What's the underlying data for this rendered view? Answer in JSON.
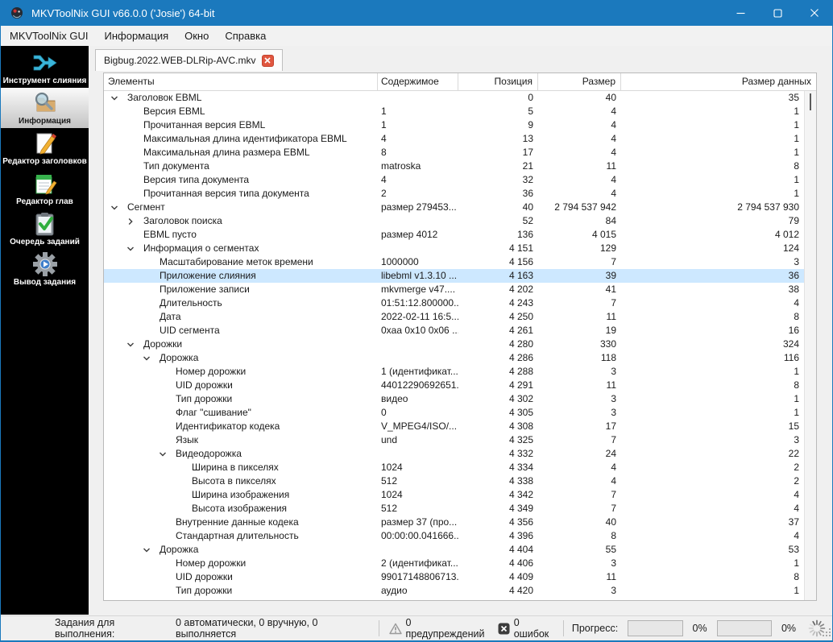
{
  "window": {
    "title": "MKVToolNix GUI v66.0.0 ('Josie') 64-bit"
  },
  "menu": {
    "items": [
      "MKVToolNix GUI",
      "Информация",
      "Окно",
      "Справка"
    ]
  },
  "sidebar": {
    "items": [
      {
        "label": "Инструмент слияния",
        "icon": "merge-tool-icon",
        "selected": false
      },
      {
        "label": "Информация",
        "icon": "info-tool-icon",
        "selected": true
      },
      {
        "label": "Редактор заголовков",
        "icon": "header-editor-icon",
        "selected": false
      },
      {
        "label": "Редактор глав",
        "icon": "chapter-editor-icon",
        "selected": false
      },
      {
        "label": "Очередь заданий",
        "icon": "job-queue-icon",
        "selected": false
      },
      {
        "label": "Вывод задания",
        "icon": "job-output-icon",
        "selected": false
      }
    ]
  },
  "tabs": {
    "active": "Bigbug.2022.WEB-DLRip-AVC.mkv"
  },
  "table": {
    "columns": {
      "elements": "Элементы",
      "content": "Содержимое",
      "position": "Позиция",
      "size": "Размер",
      "data_size": "Размер данных"
    },
    "rows": [
      {
        "label": "Заголовок EBML",
        "content": "",
        "pos": "0",
        "size": "40",
        "dsize": "35",
        "level": 0,
        "chev": "down",
        "sel": false
      },
      {
        "label": "Версия EBML",
        "content": "1",
        "pos": "5",
        "size": "4",
        "dsize": "1",
        "level": 1,
        "chev": "none",
        "sel": false
      },
      {
        "label": "Прочитанная версия EBML",
        "content": "1",
        "pos": "9",
        "size": "4",
        "dsize": "1",
        "level": 1,
        "chev": "none",
        "sel": false
      },
      {
        "label": "Максимальная длина идентификатора EBML",
        "content": "4",
        "pos": "13",
        "size": "4",
        "dsize": "1",
        "level": 1,
        "chev": "none",
        "sel": false
      },
      {
        "label": "Максимальная длина размера EBML",
        "content": "8",
        "pos": "17",
        "size": "4",
        "dsize": "1",
        "level": 1,
        "chev": "none",
        "sel": false
      },
      {
        "label": "Тип документа",
        "content": "matroska",
        "pos": "21",
        "size": "11",
        "dsize": "8",
        "level": 1,
        "chev": "none",
        "sel": false
      },
      {
        "label": "Версия типа документа",
        "content": "4",
        "pos": "32",
        "size": "4",
        "dsize": "1",
        "level": 1,
        "chev": "none",
        "sel": false
      },
      {
        "label": "Прочитанная версия типа документа",
        "content": "2",
        "pos": "36",
        "size": "4",
        "dsize": "1",
        "level": 1,
        "chev": "none",
        "sel": false
      },
      {
        "label": "Сегмент",
        "content": "размер 279453...",
        "pos": "40",
        "size": "2 794 537 942",
        "dsize": "2 794 537 930",
        "level": 0,
        "chev": "down",
        "sel": false
      },
      {
        "label": "Заголовок поиска",
        "content": "",
        "pos": "52",
        "size": "84",
        "dsize": "79",
        "level": 1,
        "chev": "right",
        "sel": false
      },
      {
        "label": "EBML пусто",
        "content": "размер 4012",
        "pos": "136",
        "size": "4 015",
        "dsize": "4 012",
        "level": 1,
        "chev": "none",
        "sel": false
      },
      {
        "label": "Информация о сегментах",
        "content": "",
        "pos": "4 151",
        "size": "129",
        "dsize": "124",
        "level": 1,
        "chev": "down",
        "sel": false
      },
      {
        "label": "Масштабирование меток времени",
        "content": "1000000",
        "pos": "4 156",
        "size": "7",
        "dsize": "3",
        "level": 2,
        "chev": "none",
        "sel": false
      },
      {
        "label": "Приложение слияния",
        "content": "libebml v1.3.10 ...",
        "pos": "4 163",
        "size": "39",
        "dsize": "36",
        "level": 2,
        "chev": "none",
        "sel": true
      },
      {
        "label": "Приложение записи",
        "content": "mkvmerge v47....",
        "pos": "4 202",
        "size": "41",
        "dsize": "38",
        "level": 2,
        "chev": "none",
        "sel": false
      },
      {
        "label": "Длительность",
        "content": "01:51:12.800000...",
        "pos": "4 243",
        "size": "7",
        "dsize": "4",
        "level": 2,
        "chev": "none",
        "sel": false
      },
      {
        "label": "Дата",
        "content": "2022-02-11 16:5...",
        "pos": "4 250",
        "size": "11",
        "dsize": "8",
        "level": 2,
        "chev": "none",
        "sel": false
      },
      {
        "label": "UID сегмента",
        "content": "0xaa 0x10 0x06 ...",
        "pos": "4 261",
        "size": "19",
        "dsize": "16",
        "level": 2,
        "chev": "none",
        "sel": false
      },
      {
        "label": "Дорожки",
        "content": "",
        "pos": "4 280",
        "size": "330",
        "dsize": "324",
        "level": 1,
        "chev": "down",
        "sel": false
      },
      {
        "label": "Дорожка",
        "content": "",
        "pos": "4 286",
        "size": "118",
        "dsize": "116",
        "level": 2,
        "chev": "down",
        "sel": false
      },
      {
        "label": "Номер дорожки",
        "content": "1 (идентификат...",
        "pos": "4 288",
        "size": "3",
        "dsize": "1",
        "level": 3,
        "chev": "none",
        "sel": false
      },
      {
        "label": "UID дорожки",
        "content": "44012290692651...",
        "pos": "4 291",
        "size": "11",
        "dsize": "8",
        "level": 3,
        "chev": "none",
        "sel": false
      },
      {
        "label": "Тип дорожки",
        "content": "видео",
        "pos": "4 302",
        "size": "3",
        "dsize": "1",
        "level": 3,
        "chev": "none",
        "sel": false
      },
      {
        "label": "Флаг \"сшивание\"",
        "content": "0",
        "pos": "4 305",
        "size": "3",
        "dsize": "1",
        "level": 3,
        "chev": "none",
        "sel": false
      },
      {
        "label": "Идентификатор кодека",
        "content": "V_MPEG4/ISO/...",
        "pos": "4 308",
        "size": "17",
        "dsize": "15",
        "level": 3,
        "chev": "none",
        "sel": false
      },
      {
        "label": "Язык",
        "content": "und",
        "pos": "4 325",
        "size": "7",
        "dsize": "3",
        "level": 3,
        "chev": "none",
        "sel": false
      },
      {
        "label": "Видеодорожка",
        "content": "",
        "pos": "4 332",
        "size": "24",
        "dsize": "22",
        "level": 3,
        "chev": "down",
        "sel": false
      },
      {
        "label": "Ширина в пикселях",
        "content": "1024",
        "pos": "4 334",
        "size": "4",
        "dsize": "2",
        "level": 4,
        "chev": "none",
        "sel": false
      },
      {
        "label": "Высота в пикселях",
        "content": "512",
        "pos": "4 338",
        "size": "4",
        "dsize": "2",
        "level": 4,
        "chev": "none",
        "sel": false
      },
      {
        "label": "Ширина изображения",
        "content": "1024",
        "pos": "4 342",
        "size": "7",
        "dsize": "4",
        "level": 4,
        "chev": "none",
        "sel": false
      },
      {
        "label": "Высота изображения",
        "content": "512",
        "pos": "4 349",
        "size": "7",
        "dsize": "4",
        "level": 4,
        "chev": "none",
        "sel": false
      },
      {
        "label": "Внутренние данные кодека",
        "content": "размер 37 (про...",
        "pos": "4 356",
        "size": "40",
        "dsize": "37",
        "level": 3,
        "chev": "none",
        "sel": false
      },
      {
        "label": "Стандартная длительность",
        "content": "00:00:00.041666...",
        "pos": "4 396",
        "size": "8",
        "dsize": "4",
        "level": 3,
        "chev": "none",
        "sel": false
      },
      {
        "label": "Дорожка",
        "content": "",
        "pos": "4 404",
        "size": "55",
        "dsize": "53",
        "level": 2,
        "chev": "down",
        "sel": false
      },
      {
        "label": "Номер дорожки",
        "content": "2 (идентификат...",
        "pos": "4 406",
        "size": "3",
        "dsize": "1",
        "level": 3,
        "chev": "none",
        "sel": false
      },
      {
        "label": "UID дорожки",
        "content": "99017148806713...",
        "pos": "4 409",
        "size": "11",
        "dsize": "8",
        "level": 3,
        "chev": "none",
        "sel": false
      },
      {
        "label": "Тип дорожки",
        "content": "аудио",
        "pos": "4 420",
        "size": "3",
        "dsize": "1",
        "level": 3,
        "chev": "none",
        "sel": false
      }
    ]
  },
  "statusbar": {
    "jobs_label": "Задания для выполнения:",
    "jobs_value": "0 автоматически, 0 вручную, 0 выполняется",
    "warnings": "0 предупреждений",
    "errors": "0 ошибок",
    "progress_label": "Прогресс:",
    "progress1_pct": "0%",
    "progress2_pct": "0%"
  },
  "colors": {
    "titlebar": "#1b79bd",
    "selection": "#cde8ff",
    "tab_close": "#e0563f",
    "sidebar_bg": "#000000"
  }
}
